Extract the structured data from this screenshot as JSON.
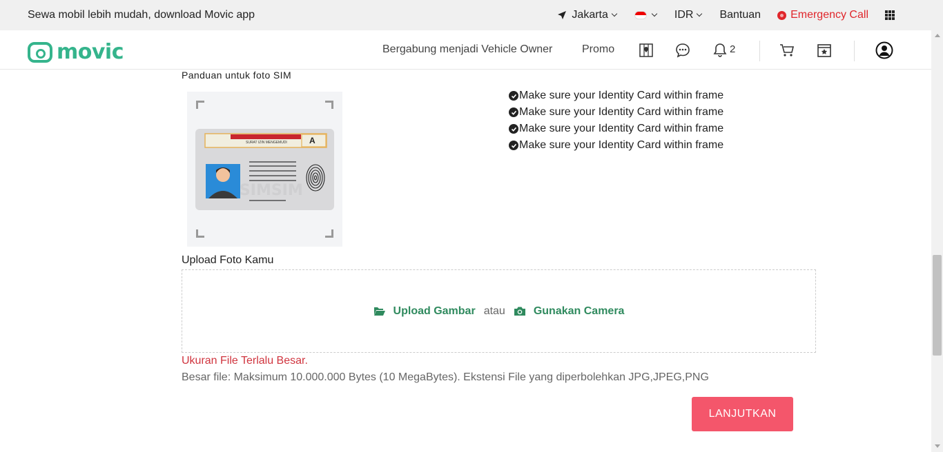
{
  "topbar": {
    "promo_text": "Sewa mobil lebih mudah, download Movic app",
    "city": "Jakarta",
    "currency": "IDR",
    "help": "Bantuan",
    "emergency": "Emergency Call"
  },
  "nav": {
    "logo_text": "movic",
    "become_owner": "Bergabung menjadi Vehicle Owner",
    "promo": "Promo",
    "notification_count": "2",
    "brand_color": "#35b48c"
  },
  "guide": {
    "title": "Panduan untuk foto SIM",
    "card_header": "SURAT IZIN MENGEMUDI",
    "card_class": "A",
    "checks": [
      "Make sure your Identity Card within frame",
      "Make sure your Identity Card within frame",
      "Make sure your Identity Card within frame",
      "Make sure your Identity Card within frame"
    ]
  },
  "upload": {
    "label": "Upload Foto Kamu",
    "upload_button": "Upload Gambar",
    "or_text": "atau",
    "camera_button": "Gunakan Camera",
    "error": "Ukuran File Terlalu Besar.",
    "hint": "Besar file: Maksimum 10.000.000 Bytes (10 MegaBytes). Ekstensi File yang diperbolehkan JPG,JPEG,PNG"
  },
  "actions": {
    "next": "LANJUTKAN",
    "next_color": "#f4566b"
  }
}
